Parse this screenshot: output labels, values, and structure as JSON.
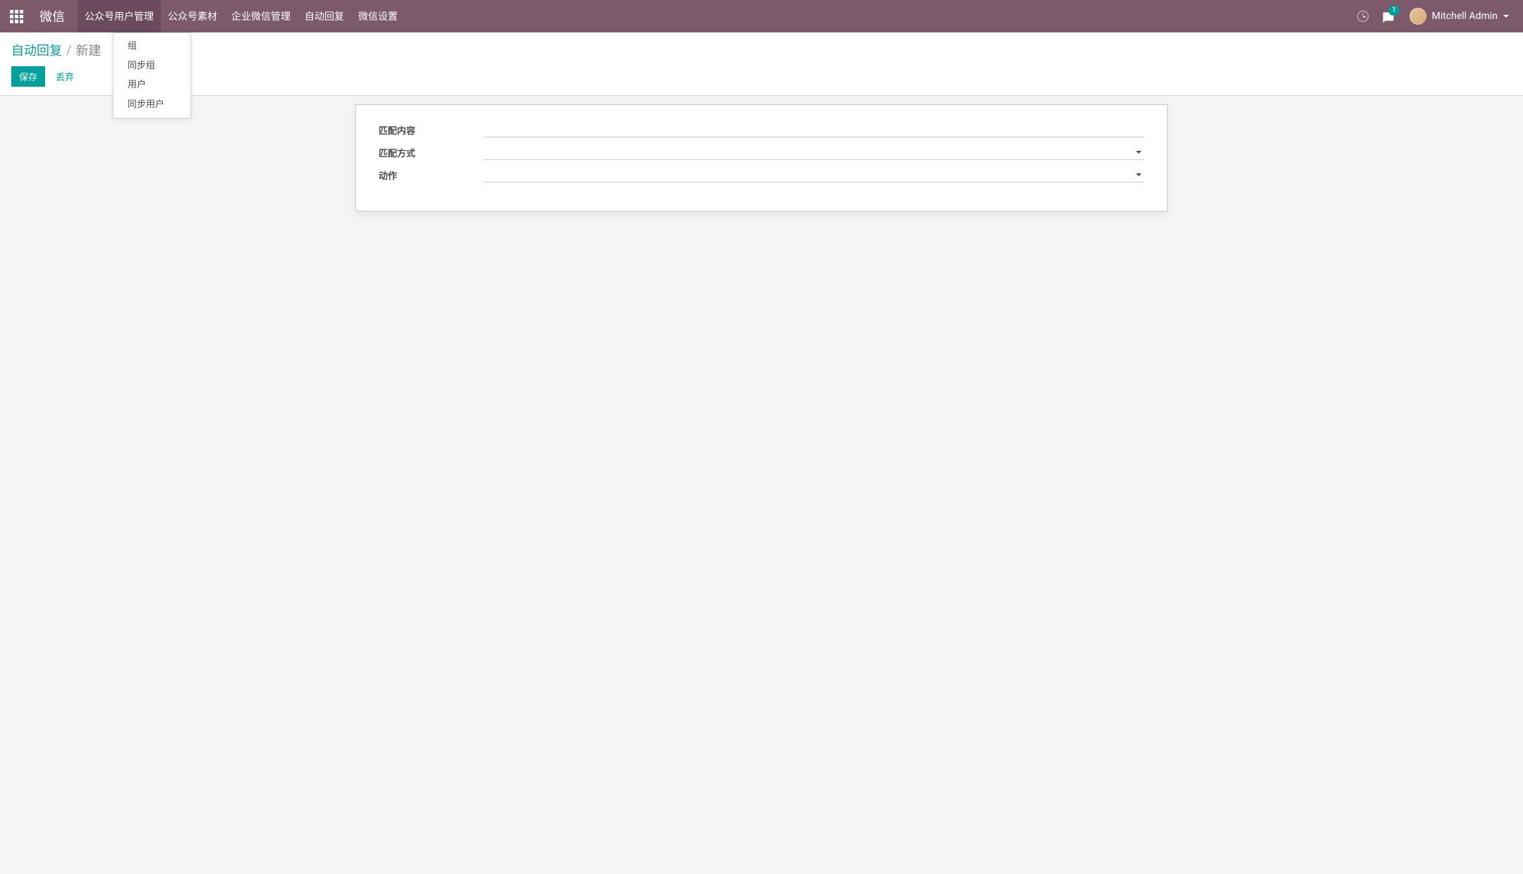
{
  "brand": "微信",
  "nav": {
    "items": [
      {
        "label": "公众号用户管理"
      },
      {
        "label": "公众号素材"
      },
      {
        "label": "企业微信管理"
      },
      {
        "label": "自动回复"
      },
      {
        "label": "微信设置"
      }
    ]
  },
  "dropdown": {
    "items": [
      {
        "label": "组"
      },
      {
        "label": "同步组"
      },
      {
        "label": "用户"
      },
      {
        "label": "同步用户"
      }
    ]
  },
  "message_badge": "1",
  "user": {
    "name": "Mitchell Admin"
  },
  "breadcrumb": {
    "parent": "自动回复",
    "sep": "/",
    "current": "新建"
  },
  "buttons": {
    "save": "保存",
    "discard": "丢弃"
  },
  "form": {
    "match_content_label": "匹配内容",
    "match_method_label": "匹配方式",
    "action_label": "动作",
    "match_content_value": "",
    "match_method_value": "",
    "action_value": ""
  }
}
